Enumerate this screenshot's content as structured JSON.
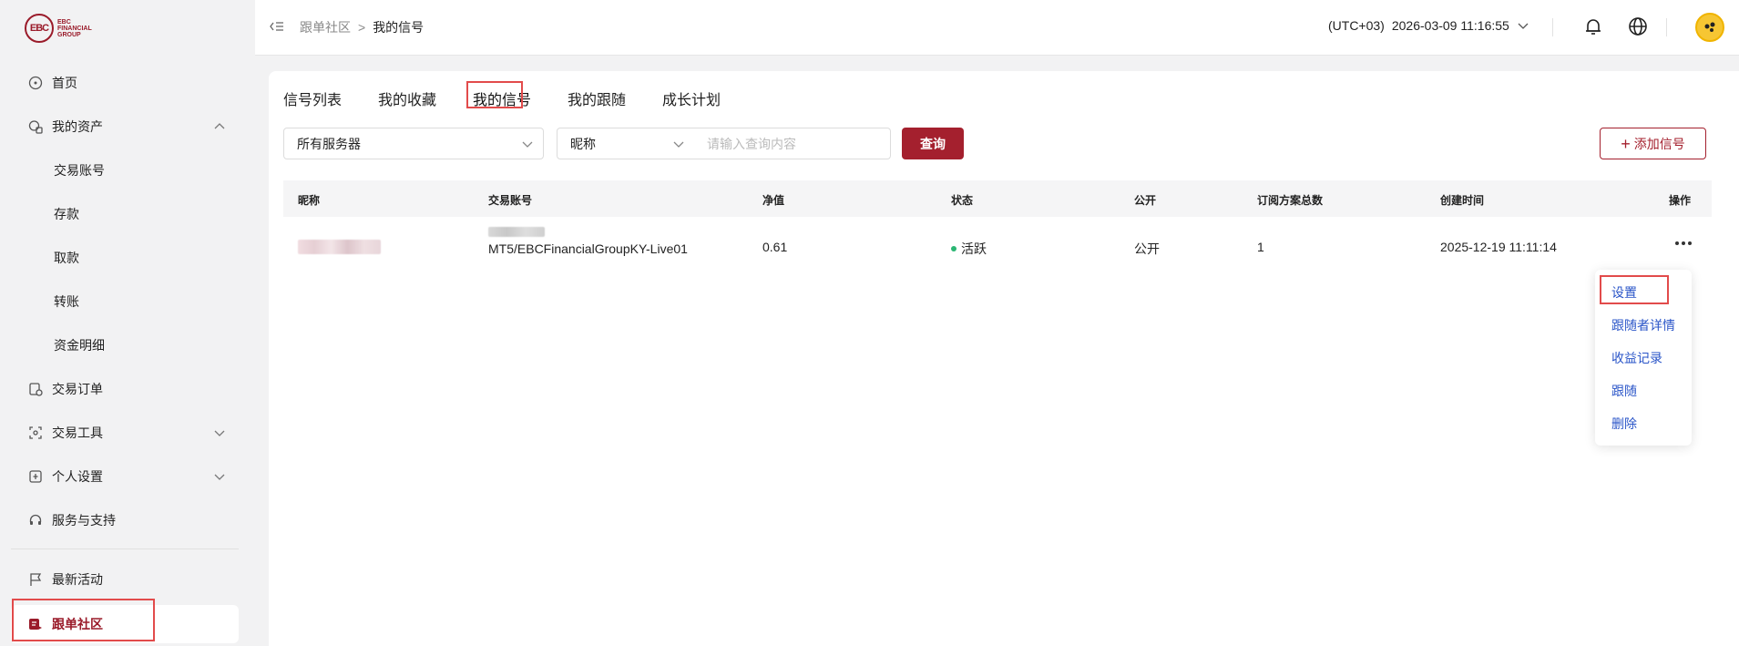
{
  "logo": {
    "mark": "EBC",
    "line1": "EBC",
    "line2": "FINANCIAL",
    "line3": "GROUP"
  },
  "sidebar": {
    "items": [
      {
        "label": "首页",
        "icon": "home-icon"
      },
      {
        "label": "我的资产",
        "icon": "assets-icon",
        "expanded": true
      },
      {
        "label": "交易账号",
        "sub": true
      },
      {
        "label": "存款",
        "sub": true
      },
      {
        "label": "取款",
        "sub": true
      },
      {
        "label": "转账",
        "sub": true
      },
      {
        "label": "资金明细",
        "sub": true
      },
      {
        "label": "交易订单",
        "icon": "orders-icon"
      },
      {
        "label": "交易工具",
        "icon": "tools-icon",
        "expanded": false
      },
      {
        "label": "个人设置",
        "icon": "settings-icon",
        "expanded": false
      },
      {
        "label": "服务与支持",
        "icon": "headset-icon"
      },
      {
        "label": "最新活动",
        "icon": "flag-icon"
      },
      {
        "label": "跟单社区",
        "icon": "copy-trade-icon",
        "active": true
      }
    ]
  },
  "header": {
    "breadcrumb": {
      "parent": "跟单社区",
      "sep": ">",
      "current": "我的信号"
    },
    "timezone": "(UTC+03)",
    "datetime": "2026-03-09 11:16:55"
  },
  "tabs": [
    "信号列表",
    "我的收藏",
    "我的信号",
    "我的跟随",
    "成长计划"
  ],
  "active_tab": "我的信号",
  "filters": {
    "server": "所有服务器",
    "field": "昵称",
    "search_placeholder": "请输入查询内容",
    "query_label": "查询",
    "add_label": "添加信号",
    "add_icon": "+"
  },
  "table": {
    "columns": [
      "昵称",
      "交易账号",
      "净值",
      "状态",
      "公开",
      "订阅方案总数",
      "创建时间",
      "操作"
    ],
    "rows": [
      {
        "account_server": "MT5/EBCFinancialGroupKY-Live01",
        "equity": "0.61",
        "status": "活跃",
        "status_color": "#2bb673",
        "public": "公开",
        "plans": "1",
        "created": "2025-12-19 11:11:14"
      }
    ]
  },
  "action_menu": [
    "设置",
    "跟随者详情",
    "收益记录",
    "跟随",
    "删除"
  ],
  "colors": {
    "brand": "#a4202e",
    "link": "#2a55c8",
    "highlight": "#e24b4b"
  }
}
